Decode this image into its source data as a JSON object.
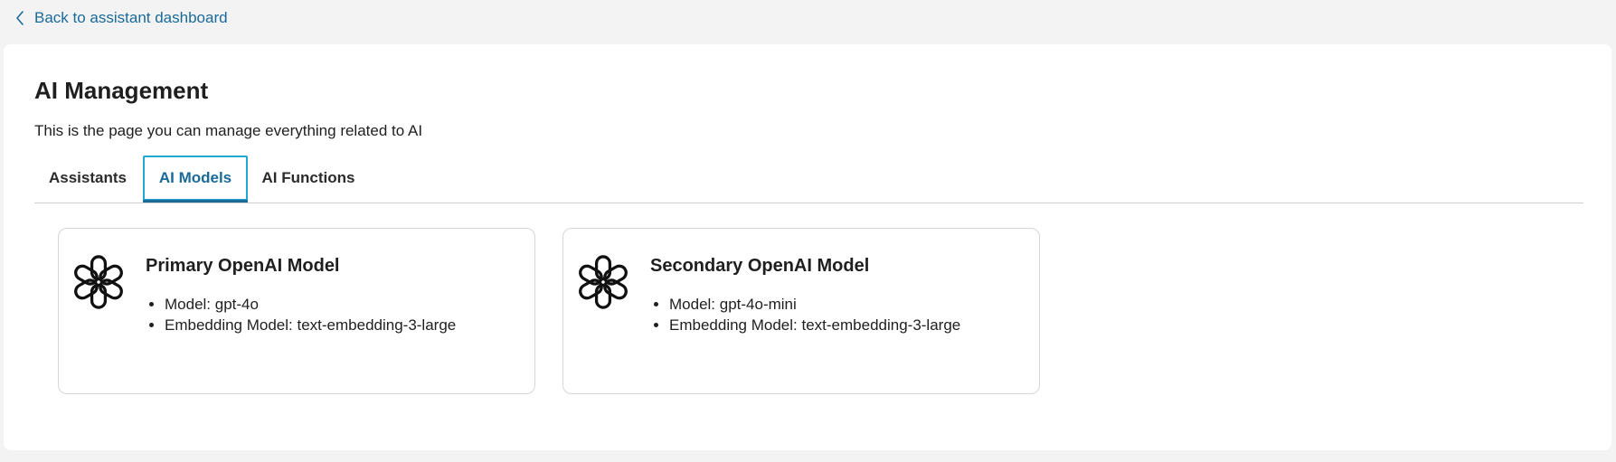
{
  "nav": {
    "back_label": "Back to assistant dashboard"
  },
  "page": {
    "title": "AI Management",
    "subtitle": "This is the page you can manage everything related to AI"
  },
  "tabs": [
    {
      "label": "Assistants",
      "active": false
    },
    {
      "label": "AI Models",
      "active": true
    },
    {
      "label": "AI Functions",
      "active": false
    }
  ],
  "models": [
    {
      "title": "Primary OpenAI Model",
      "icon": "openai-logo-icon",
      "details": [
        "Model: gpt-4o",
        "Embedding Model: text-embedding-3-large"
      ]
    },
    {
      "title": "Secondary OpenAI Model",
      "icon": "openai-logo-icon",
      "details": [
        "Model: gpt-4o-mini",
        "Embedding Model: text-embedding-3-large"
      ]
    }
  ],
  "colors": {
    "link": "#1a6a99",
    "active_tab_border": "#22a7d3",
    "page_background": "#f3f3f3",
    "panel_background": "#ffffff"
  }
}
